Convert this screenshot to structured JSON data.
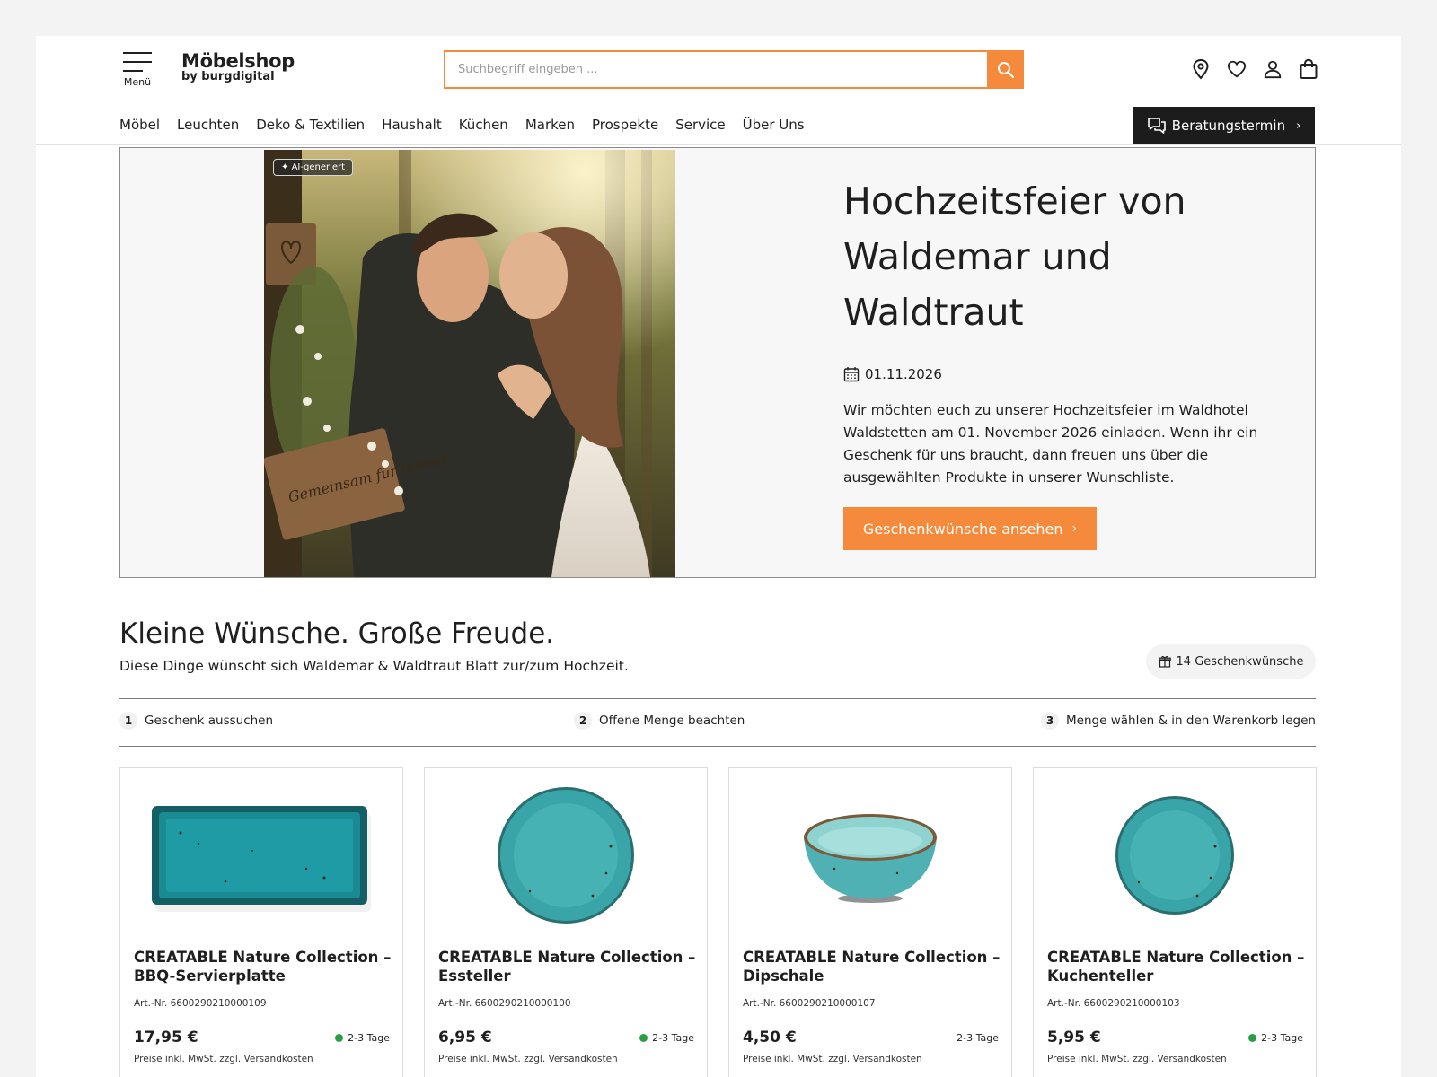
{
  "header": {
    "menu_label": "Menü",
    "logo_title": "Möbelshop",
    "logo_sub": "by burgdigital",
    "search_placeholder": "Suchbegriff eingeben ...",
    "icons": [
      "location-icon",
      "heart-icon",
      "user-icon",
      "bag-icon"
    ]
  },
  "nav": {
    "items": [
      "Möbel",
      "Leuchten",
      "Deko & Textilien",
      "Haushalt",
      "Küchen",
      "Marken",
      "Prospekte",
      "Service",
      "Über Uns"
    ],
    "cta_label": "Beratungstermin"
  },
  "hero": {
    "ai_badge": "AI-generiert",
    "sign_text": "Gemeinsam für immer",
    "title": "Hochzeitsfeier von Waldemar und Waldtraut",
    "date": "01.11.2026",
    "text": "Wir möchten euch zu unserer Hochzeitsfeier im Waldhotel Waldstetten am 01. November 2026 einladen. Wenn ihr ein Geschenk für uns braucht, dann freuen uns über die ausgewählten Produkte in unserer Wunschliste.",
    "button_label": "Geschenkwünsche ansehen"
  },
  "section": {
    "title": "Kleine Wünsche. Große Freude.",
    "subtitle": "Diese Dinge wünscht sich Waldemar & Waldtraut Blatt zur/zum Hochzeit.",
    "count_label": "14 Geschenkwünsche"
  },
  "steps": [
    {
      "num": "1",
      "label": "Geschenk aussuchen"
    },
    {
      "num": "2",
      "label": "Offene Menge beachten"
    },
    {
      "num": "3",
      "label": "Menge wählen & in den Warenkorb legen"
    }
  ],
  "products": [
    {
      "name": "CREATABLE Nature Collection – BBQ-Servierplatte",
      "art": "Art.-Nr. 6600290210000109",
      "price": "17,95 €",
      "delivery": "2-3 Tage",
      "tax": "Preise inkl. MwSt. zzgl. Versandkosten"
    },
    {
      "name": "CREATABLE Nature Collection – Essteller",
      "art": "Art.-Nr. 6600290210000100",
      "price": "6,95 €",
      "delivery": "2-3 Tage",
      "tax": "Preise inkl. MwSt. zzgl. Versandkosten"
    },
    {
      "name": "CREATABLE Nature Collection – Dipschale",
      "art": "Art.-Nr. 6600290210000107",
      "price": "4,50 €",
      "delivery": "2-3 Tage",
      "tax": "Preise inkl. MwSt. zzgl. Versandkosten"
    },
    {
      "name": "CREATABLE Nature Collection – Kuchenteller",
      "art": "Art.-Nr. 6600290210000103",
      "price": "5,95 €",
      "delivery": "2-3 Tage",
      "tax": "Preise inkl. MwSt. zzgl. Versandkosten"
    }
  ],
  "colors": {
    "accent": "#f68a3c",
    "dark_button": "#1c1c1c",
    "in_stock": "#27a045",
    "turquoise": "#2a9ea8"
  }
}
